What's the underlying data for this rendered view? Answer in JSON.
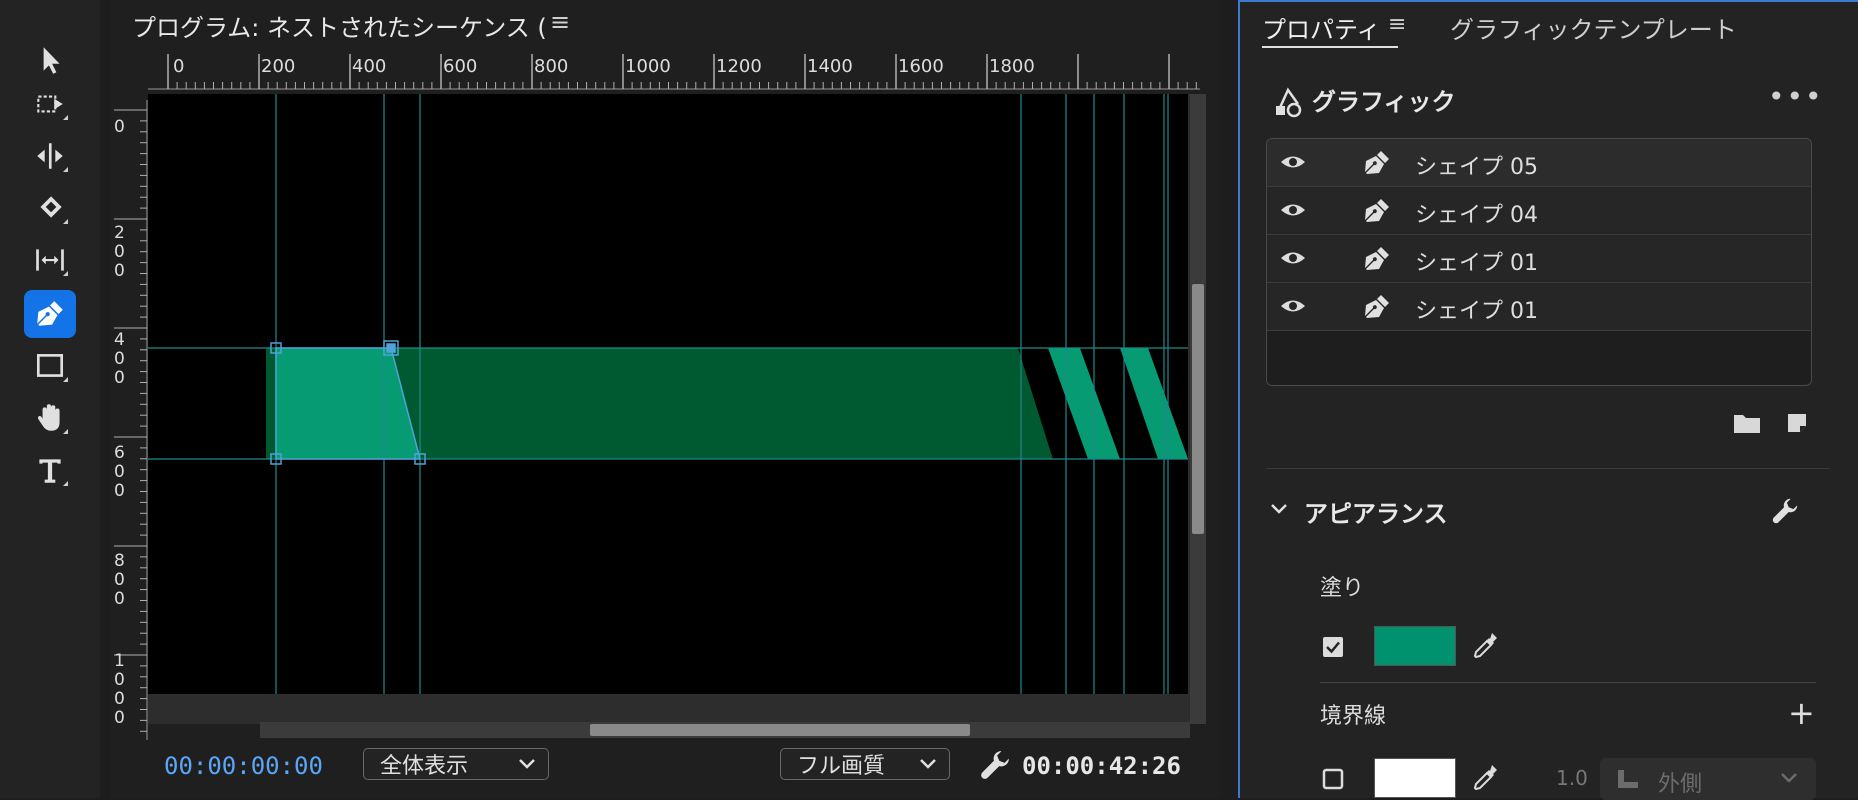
{
  "toolbar": {
    "tools": [
      {
        "name": "selection-tool",
        "icon": "arrow-icon",
        "active": false
      },
      {
        "name": "track-select-tool",
        "icon": "track-select-icon",
        "active": false
      },
      {
        "name": "ripple-edit-tool",
        "icon": "ripple-edit-icon",
        "active": false
      },
      {
        "name": "razor-tool",
        "icon": "razor-icon",
        "active": false
      },
      {
        "name": "slip-tool",
        "icon": "slip-icon",
        "active": false
      },
      {
        "name": "pen-tool",
        "icon": "pen-icon",
        "active": true
      },
      {
        "name": "rectangle-tool",
        "icon": "rectangle-icon",
        "active": false
      },
      {
        "name": "hand-tool",
        "icon": "hand-icon",
        "active": false
      },
      {
        "name": "type-tool",
        "icon": "type-icon",
        "active": false
      }
    ]
  },
  "monitor": {
    "title": "プログラム: ネストされたシーケンス (",
    "menu_glyph": "≡",
    "ruler_h_labels": [
      "0",
      "200",
      "400",
      "600",
      "800",
      "1000",
      "1200",
      "1400",
      "1600",
      "1800"
    ],
    "ruler_v_labels": [
      [
        "0"
      ],
      [
        "2",
        "0",
        "0"
      ],
      [
        "4",
        "0",
        "0"
      ],
      [
        "6",
        "0",
        "0"
      ],
      [
        "8",
        "0",
        "0"
      ],
      [
        "1",
        "0",
        "0",
        "0"
      ]
    ],
    "timecode_start": "00:00:00:00",
    "zoom_select": "全体表示",
    "quality_select": "フル画質",
    "timecode_end": "00:00:42:26"
  },
  "properties": {
    "tab_properties": "プロパティ",
    "tab_menu_glyph": "≡",
    "tab_templates": "グラフィックテンプレート",
    "graphic_title": "グラフィック",
    "more_glyph": "•••",
    "layers": [
      {
        "name": "シェイプ 05"
      },
      {
        "name": "シェイプ 04"
      },
      {
        "name": "シェイプ 01"
      },
      {
        "name": "シェイプ 01"
      }
    ],
    "appearance_title": "アピアランス",
    "fill_label": "塗り",
    "fill_enabled": true,
    "fill_color": "#00916e",
    "stroke_label": "境界線",
    "stroke_add_glyph": "+",
    "stroke_enabled": false,
    "stroke_color": "#ffffff",
    "stroke_width": "1.0",
    "stroke_position": "外側"
  },
  "colors": {
    "accent_blue": "#1473e6",
    "shape_green": "#069b73",
    "shape_dark_green": "#005a31",
    "guide_teal": "#1e8a8a",
    "timecode_blue": "#5aa6f5"
  }
}
